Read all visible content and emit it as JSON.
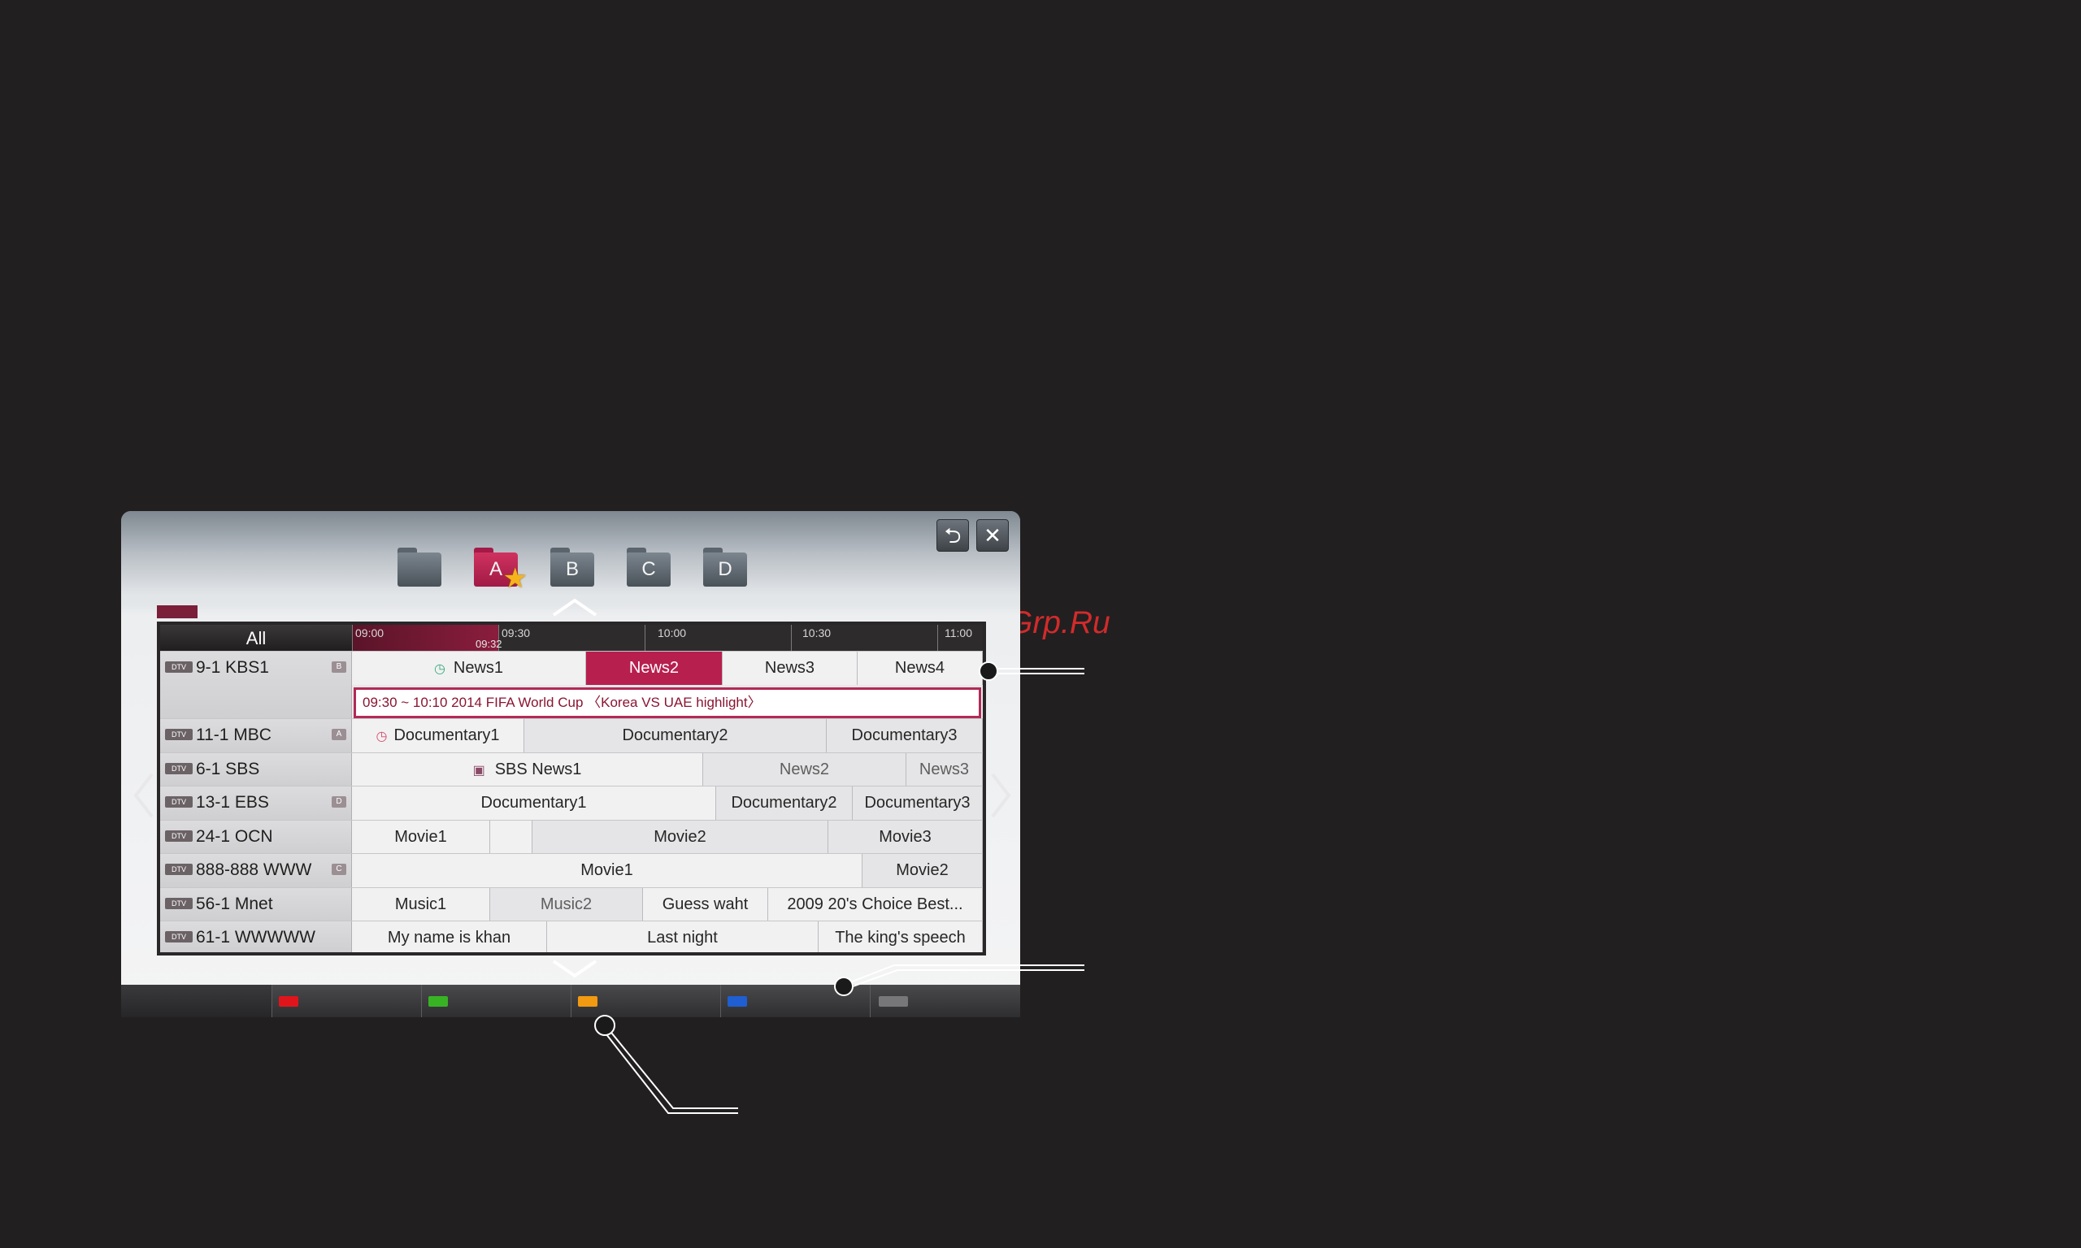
{
  "watermark": "McGrp.Ru",
  "folders": [
    {
      "label": ""
    },
    {
      "label": "A"
    },
    {
      "label": "B"
    },
    {
      "label": "C"
    },
    {
      "label": "D"
    }
  ],
  "top_buttons": {
    "back": "⮌",
    "close": "✕"
  },
  "header": {
    "all_label": "All",
    "ticks": [
      "09:00",
      "09:30",
      "10:00",
      "10:30",
      "11:00"
    ],
    "now_time": "09:32"
  },
  "detail": "09:30 ~ 10:10  2014 FIFA World Cup 〈Korea VS UAE highlight〉",
  "channels": [
    {
      "tag": "DTV",
      "name": "9-1 KBS1",
      "fav": "B",
      "programs": [
        "News1",
        "News2",
        "News3",
        "News4"
      ]
    },
    {
      "tag": "DTV",
      "name": "11-1 MBC",
      "fav": "A",
      "programs": [
        "Documentary1",
        "Documentary2",
        "Documentary3"
      ]
    },
    {
      "tag": "DTV",
      "name": "6-1 SBS",
      "fav": "",
      "programs": [
        "SBS News1",
        "News2",
        "News3"
      ]
    },
    {
      "tag": "DTV",
      "name": "13-1 EBS",
      "fav": "D",
      "programs": [
        "Documentary1",
        "Documentary2",
        "Documentary3"
      ]
    },
    {
      "tag": "DTV",
      "name": "24-1 OCN",
      "fav": "",
      "programs": [
        "Movie1",
        "",
        "Movie2",
        "Movie3"
      ]
    },
    {
      "tag": "DTV",
      "name": "888-888 WWW",
      "fav": "C",
      "programs": [
        "Movie1",
        "Movie2"
      ]
    },
    {
      "tag": "DTV",
      "name": "56-1 Mnet",
      "fav": "",
      "programs": [
        "Music1",
        "Music2",
        "Guess waht",
        "2009 20's Choice Best..."
      ]
    },
    {
      "tag": "DTV",
      "name": "61-1 WWWWW",
      "fav": "",
      "programs": [
        "My name is khan",
        "Last night",
        "The king's speech"
      ]
    }
  ],
  "colors": {
    "accent": "#b71f4f",
    "red_key": "#e0151b",
    "green_key": "#38b324",
    "yellow_key": "#f19a12",
    "blue_key": "#1f5fd1"
  }
}
